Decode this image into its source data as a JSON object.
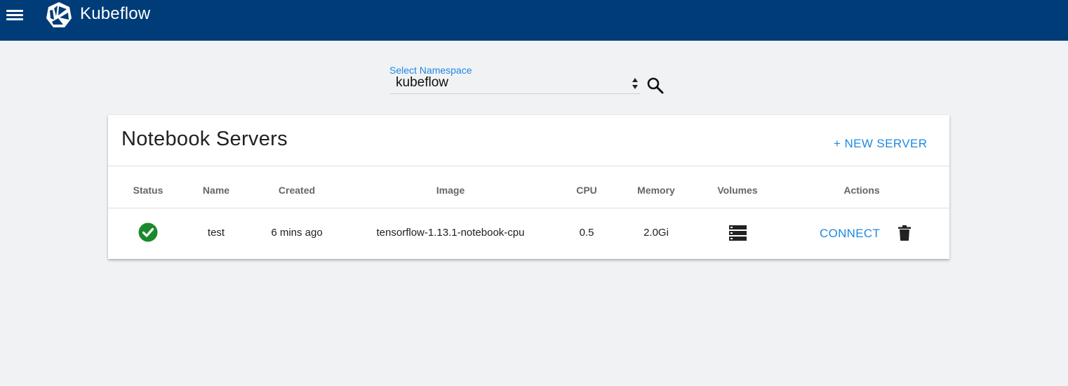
{
  "header": {
    "app_title": "Kubeflow",
    "menu_icon": "menu-icon",
    "logo_icon": "kubeflow-logo-icon",
    "background_color": "#003c77"
  },
  "namespace_selector": {
    "label": "Select Namespace",
    "value": "kubeflow",
    "search_icon": "search-icon"
  },
  "card": {
    "title": "Notebook Servers",
    "new_server_label": "+ NEW SERVER",
    "columns": [
      "Status",
      "Name",
      "Created",
      "Image",
      "CPU",
      "Memory",
      "Volumes",
      "Actions"
    ],
    "rows": [
      {
        "status": "running",
        "status_icon": "check-circle-icon",
        "name": "test",
        "created": "6 mins ago",
        "image": "tensorflow-1.13.1-notebook-cpu",
        "cpu": "0.5",
        "memory": "2.0Gi",
        "volumes_icon": "storage-icon",
        "connect_label": "CONNECT",
        "delete_icon": "delete-icon"
      }
    ]
  },
  "colors": {
    "accent": "#1e88e5",
    "success": "#1b8a2e",
    "page_background": "#f1f2f4"
  }
}
